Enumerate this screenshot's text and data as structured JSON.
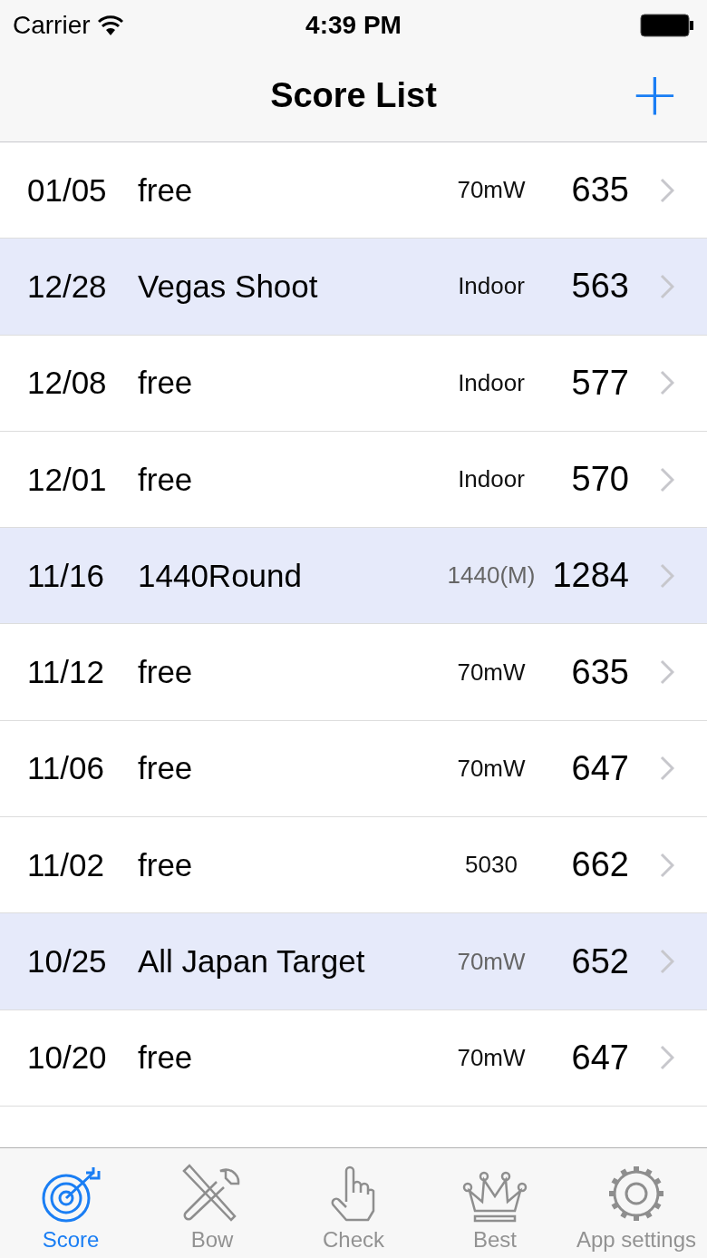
{
  "status_bar": {
    "carrier": "Carrier",
    "time": "4:39 PM"
  },
  "nav_bar": {
    "title": "Score List",
    "add_button": "+"
  },
  "rows": [
    {
      "date": "01/05",
      "name": "free",
      "round": "70mW",
      "round_muted": false,
      "score": "635",
      "highlighted": false
    },
    {
      "date": "12/28",
      "name": "Vegas Shoot",
      "round": "Indoor",
      "round_muted": false,
      "score": "563",
      "highlighted": true
    },
    {
      "date": "12/08",
      "name": "free",
      "round": "Indoor",
      "round_muted": false,
      "score": "577",
      "highlighted": false
    },
    {
      "date": "12/01",
      "name": "free",
      "round": "Indoor",
      "round_muted": false,
      "score": "570",
      "highlighted": false
    },
    {
      "date": "11/16",
      "name": "1440Round",
      "round": "1440(M)",
      "round_muted": true,
      "score": "1284",
      "highlighted": true
    },
    {
      "date": "11/12",
      "name": "free",
      "round": "70mW",
      "round_muted": false,
      "score": "635",
      "highlighted": false
    },
    {
      "date": "11/06",
      "name": "free",
      "round": "70mW",
      "round_muted": false,
      "score": "647",
      "highlighted": false
    },
    {
      "date": "11/02",
      "name": "free",
      "round": "5030",
      "round_muted": false,
      "score": "662",
      "highlighted": false
    },
    {
      "date": "10/25",
      "name": "All Japan Target",
      "round": "70mW",
      "round_muted": true,
      "score": "652",
      "highlighted": true
    },
    {
      "date": "10/20",
      "name": "free",
      "round": "70mW",
      "round_muted": false,
      "score": "647",
      "highlighted": false
    }
  ],
  "tabs": [
    {
      "label": "Score",
      "kind": "target",
      "selected": true
    },
    {
      "label": "Bow",
      "kind": "tools",
      "selected": false
    },
    {
      "label": "Check",
      "kind": "hand",
      "selected": false
    },
    {
      "label": "Best",
      "kind": "crown",
      "selected": false
    },
    {
      "label": "App settings",
      "kind": "gear",
      "selected": false
    }
  ]
}
